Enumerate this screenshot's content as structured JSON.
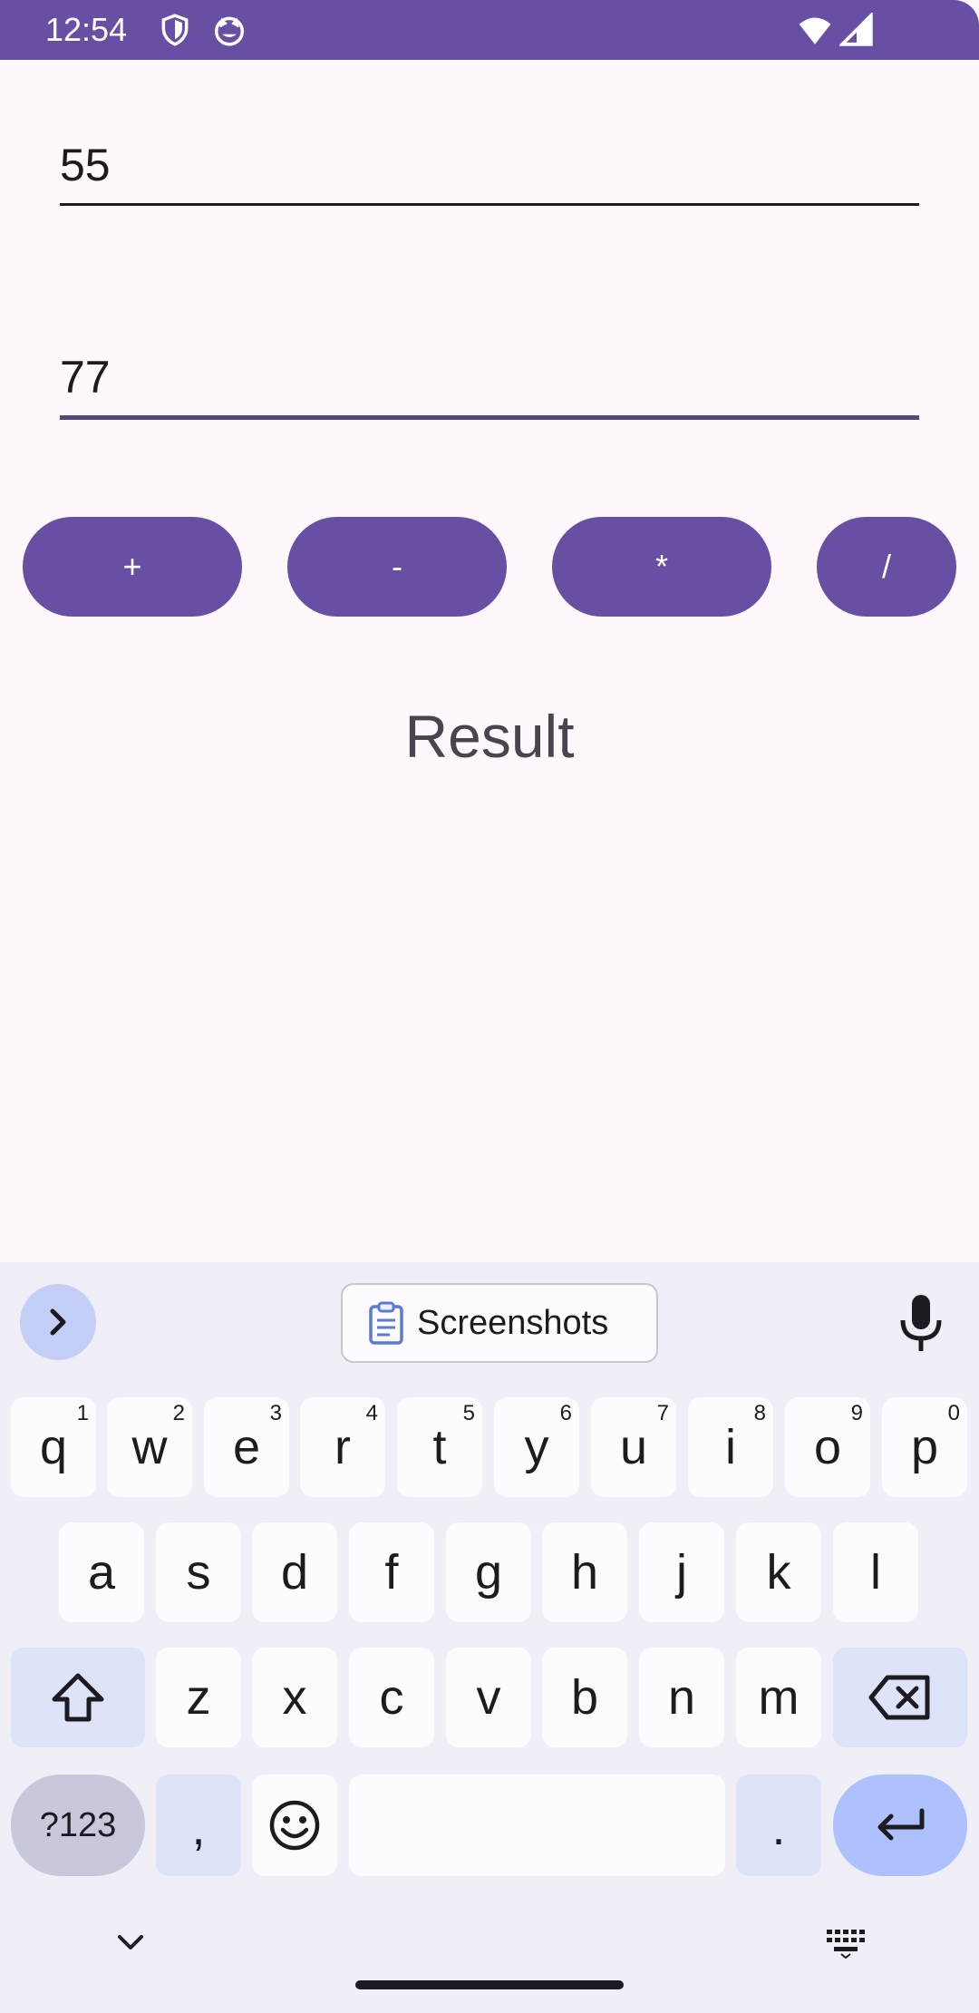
{
  "status_bar": {
    "time": "12:54",
    "icons": [
      "shield-icon",
      "cat-icon",
      "wifi-icon",
      "cellular-icon"
    ]
  },
  "fields": {
    "first_value": "55",
    "second_value": "77"
  },
  "operations": {
    "add": "+",
    "subtract": "-",
    "multiply": "*",
    "divide": "/"
  },
  "result_label": "Result",
  "keyboard": {
    "suggestion_chip": "Screenshots",
    "row1": [
      {
        "key": "q",
        "hint": "1"
      },
      {
        "key": "w",
        "hint": "2"
      },
      {
        "key": "e",
        "hint": "3"
      },
      {
        "key": "r",
        "hint": "4"
      },
      {
        "key": "t",
        "hint": "5"
      },
      {
        "key": "y",
        "hint": "6"
      },
      {
        "key": "u",
        "hint": "7"
      },
      {
        "key": "i",
        "hint": "8"
      },
      {
        "key": "o",
        "hint": "9"
      },
      {
        "key": "p",
        "hint": "0"
      }
    ],
    "row2": [
      "a",
      "s",
      "d",
      "f",
      "g",
      "h",
      "j",
      "k",
      "l"
    ],
    "row3": [
      "z",
      "x",
      "c",
      "v",
      "b",
      "n",
      "m"
    ],
    "symbols_label": "?123",
    "comma": ",",
    "period": "."
  },
  "colors": {
    "primary": "#6750a4",
    "background": "#fef7fc",
    "keyboard_bg": "#f0eef6",
    "enter_key": "#aec1fe"
  }
}
